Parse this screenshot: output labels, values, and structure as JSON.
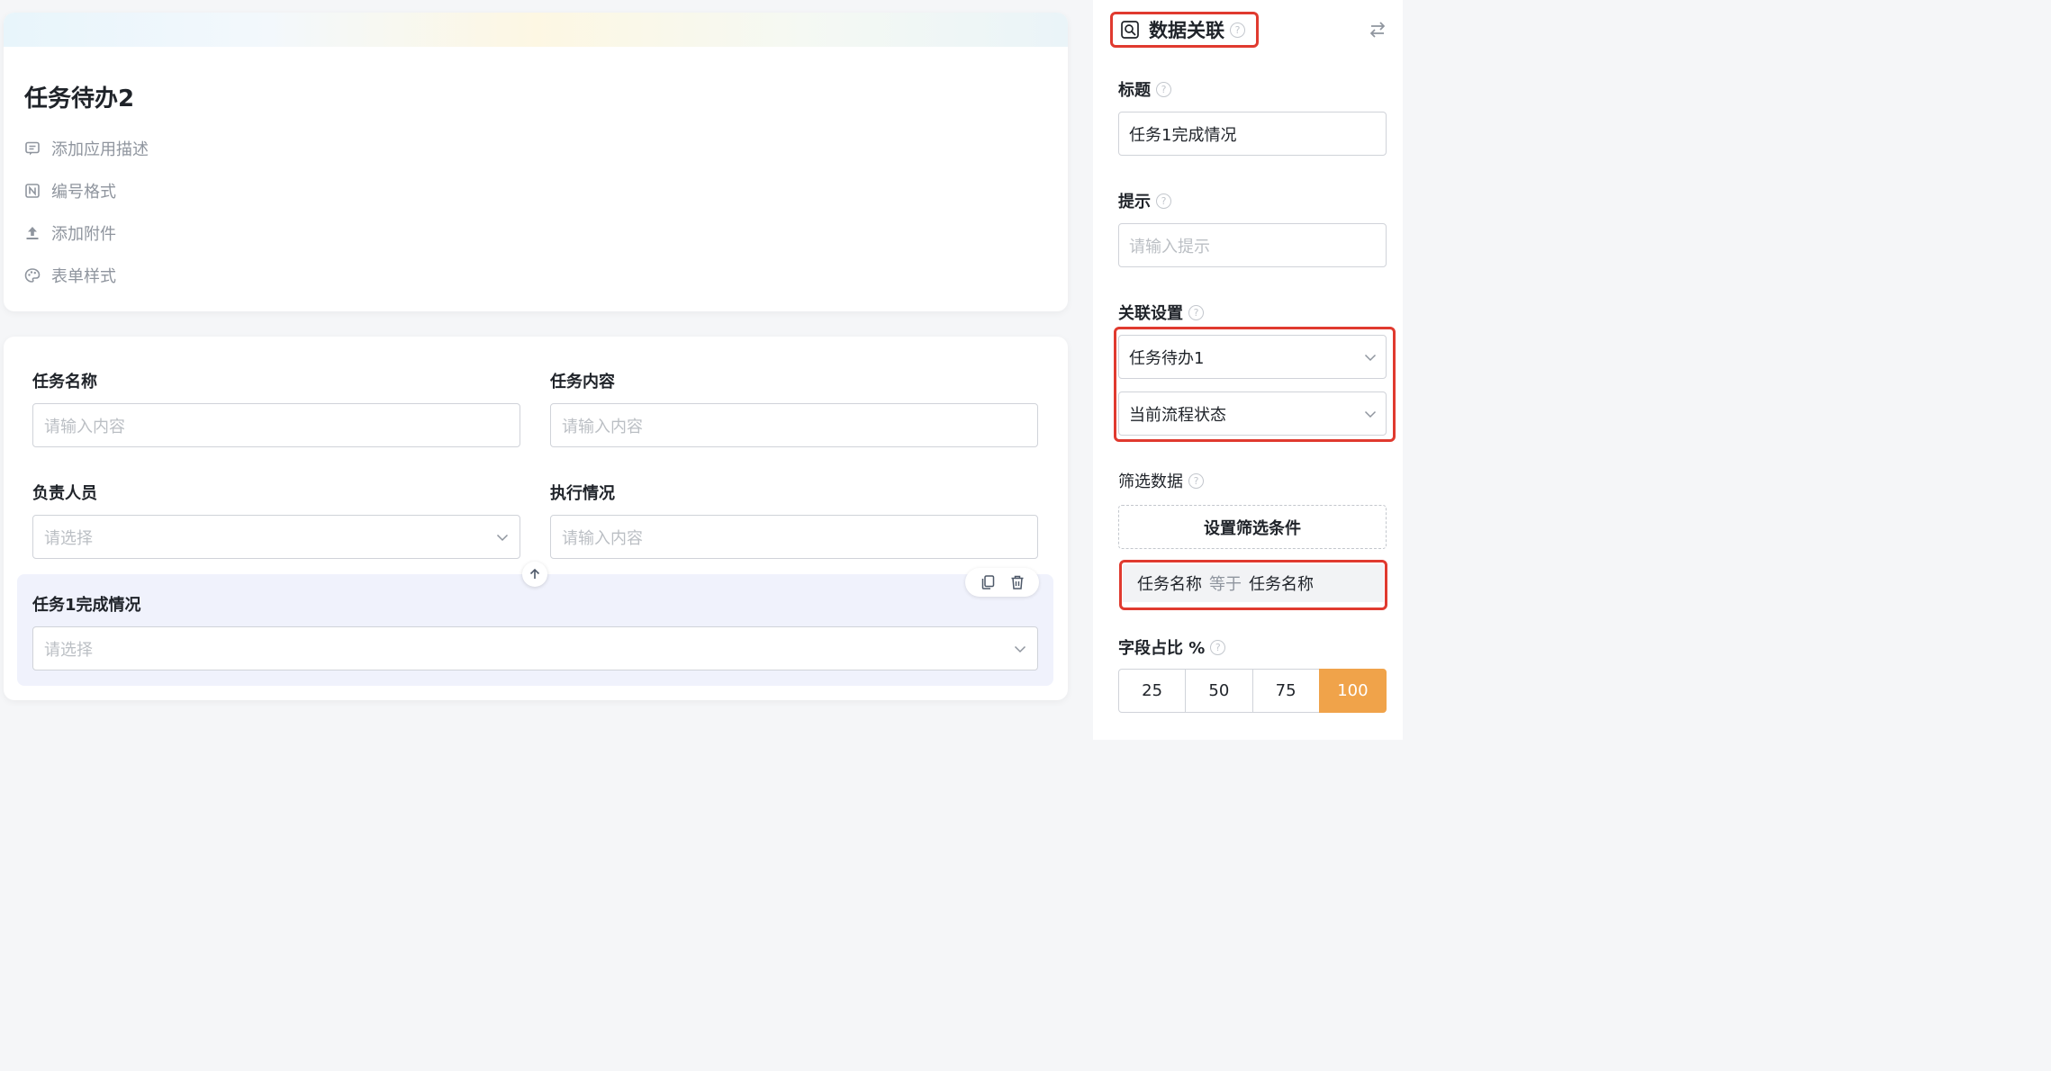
{
  "app": {
    "title": "任务待办2",
    "meta": [
      {
        "label": "添加应用描述",
        "icon": "comment-icon"
      },
      {
        "label": "编号格式",
        "icon": "number-format-icon"
      },
      {
        "label": "添加附件",
        "icon": "upload-icon"
      },
      {
        "label": "表单样式",
        "icon": "palette-icon"
      }
    ]
  },
  "form": {
    "fields": [
      {
        "label": "任务名称",
        "placeholder": "请输入内容",
        "type": "text"
      },
      {
        "label": "任务内容",
        "placeholder": "请输入内容",
        "type": "text"
      },
      {
        "label": "负责人员",
        "placeholder": "请选择",
        "type": "select"
      },
      {
        "label": "执行情况",
        "placeholder": "请输入内容",
        "type": "text"
      },
      {
        "label": "任务1完成情况",
        "placeholder": "请选择",
        "type": "select"
      }
    ]
  },
  "panel": {
    "header": {
      "title": "数据关联",
      "icon": "data-link-icon"
    },
    "title_section": {
      "label": "标题",
      "value": "任务1完成情况"
    },
    "hint_section": {
      "label": "提示",
      "placeholder": "请输入提示"
    },
    "link_settings": {
      "label": "关联设置",
      "form_value": "任务待办1",
      "field_value": "当前流程状态"
    },
    "filter": {
      "label": "筛选数据",
      "button_label": "设置筛选条件",
      "condition": {
        "field": "任务名称",
        "operator": "等于",
        "value": "任务名称"
      }
    },
    "width_ratio": {
      "label": "字段占比 %",
      "options": [
        "25",
        "50",
        "75",
        "100"
      ],
      "selected": "100"
    }
  },
  "colors": {
    "accent": "#f0a34a",
    "highlight_border": "#e03a2f",
    "selected_bg": "#f0f2fc"
  }
}
